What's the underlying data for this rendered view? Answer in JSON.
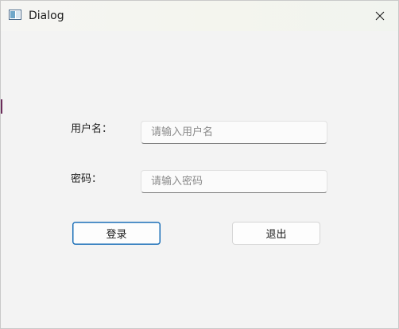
{
  "window": {
    "title": "Dialog",
    "icon": "dialog-window-icon",
    "close_icon": "close-icon"
  },
  "form": {
    "username_label": "用户名：",
    "username_placeholder": "请输入用户名",
    "username_value": "",
    "password_label": "密码：",
    "password_placeholder": "请输入密码",
    "password_value": ""
  },
  "buttons": {
    "login_label": "登录",
    "exit_label": "退出"
  },
  "colors": {
    "background": "#f3f3f3",
    "default_button_border": "#1b6fb8",
    "field_underline": "#7a7a7a"
  }
}
